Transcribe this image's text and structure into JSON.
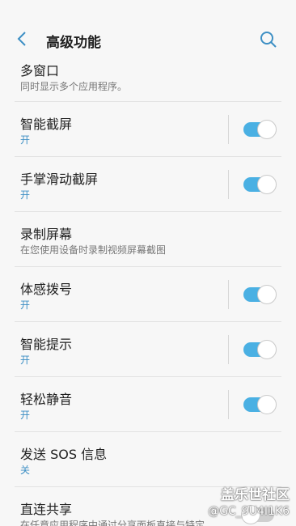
{
  "header": {
    "title": "高级功能",
    "back_icon": "back-arrow-icon",
    "search_icon": "search-icon",
    "accent": "#3d8fc4"
  },
  "items": [
    {
      "title": "多窗口",
      "subtitle": "同时显示多个应用程序。"
    },
    {
      "title": "智能截屏",
      "subtitle": "开",
      "toggle": true
    },
    {
      "title": "手掌滑动截屏",
      "subtitle": "开",
      "toggle": true
    },
    {
      "title": "录制屏幕",
      "subtitle": "在您使用设备时录制视频屏幕截图"
    },
    {
      "title": "体感拨号",
      "subtitle": "开",
      "toggle": true
    },
    {
      "title": "智能提示",
      "subtitle": "开",
      "toggle": true
    },
    {
      "title": "轻松静音",
      "subtitle": "开",
      "toggle": true
    },
    {
      "title": "发送 SOS 信息",
      "subtitle": "关"
    },
    {
      "title": "直连共享",
      "subtitle": "在任意应用程序中通过分享面板直接与特定",
      "toggle": false
    }
  ],
  "watermark": {
    "brand": "盖乐世社区",
    "handle": "@GC_9U4I1K6"
  },
  "colors": {
    "toggle_on": "#4ab0e3",
    "toggle_off": "#cfcfcf",
    "background": "#f7f7f7"
  }
}
